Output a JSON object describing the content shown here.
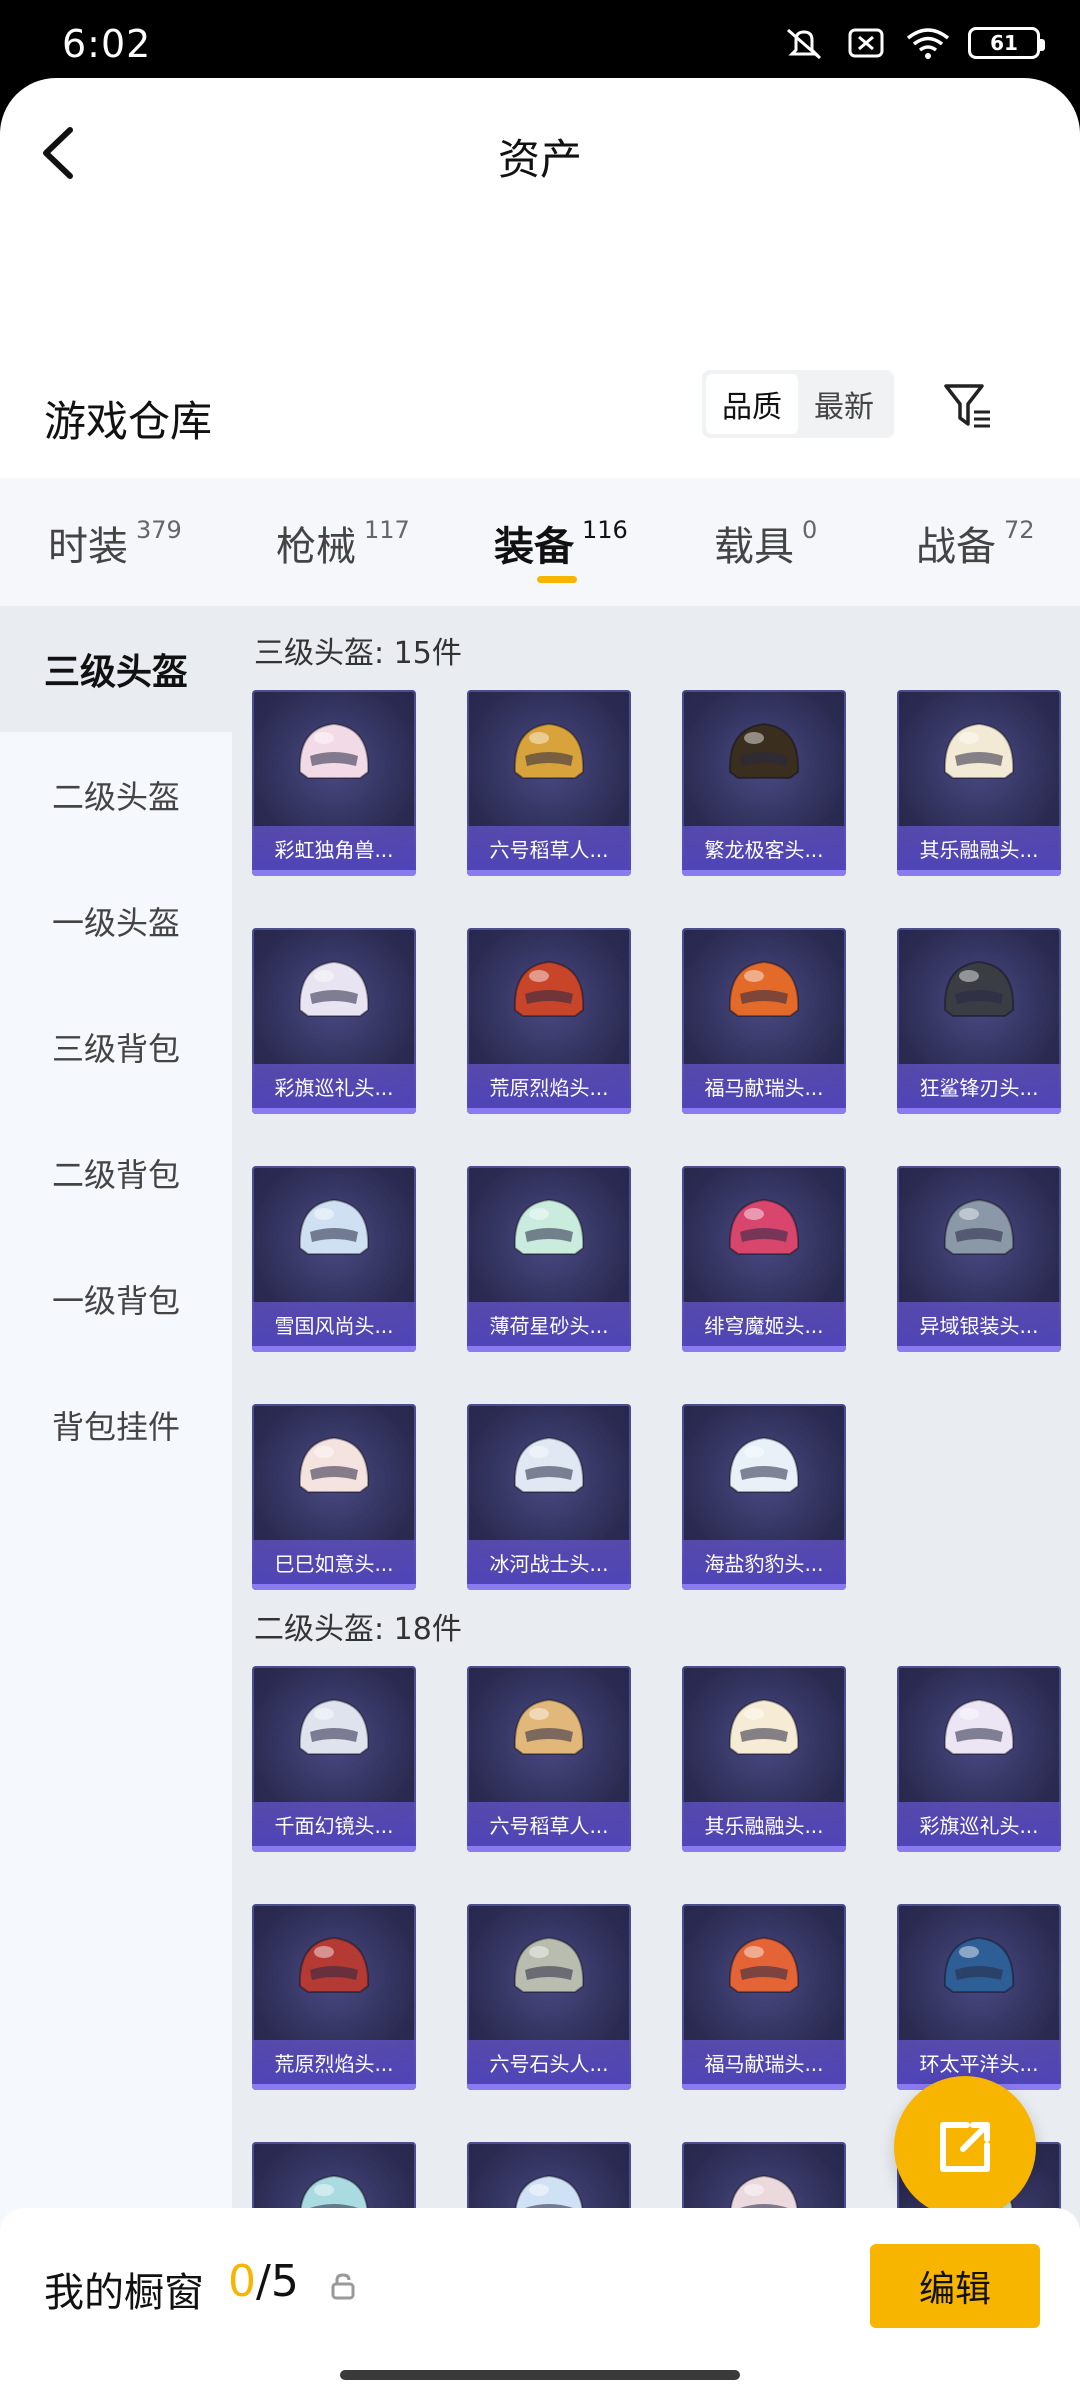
{
  "status_bar": {
    "time": "6:02",
    "battery": "61"
  },
  "nav": {
    "title": "资产"
  },
  "warehouse": {
    "title": "游戏仓库",
    "sort_options": [
      "品质",
      "最新"
    ],
    "active_sort": "品质"
  },
  "categories": [
    {
      "label": "时装",
      "count": "379"
    },
    {
      "label": "枪械",
      "count": "117"
    },
    {
      "label": "装备",
      "count": "116",
      "active": true
    },
    {
      "label": "载具",
      "count": "0"
    },
    {
      "label": "战备",
      "count": "72"
    }
  ],
  "sidebar": [
    {
      "label": "三级头盔",
      "active": true
    },
    {
      "label": "二级头盔"
    },
    {
      "label": "一级头盔"
    },
    {
      "label": "三级背包"
    },
    {
      "label": "二级背包"
    },
    {
      "label": "一级背包"
    },
    {
      "label": "背包挂件"
    }
  ],
  "sections": [
    {
      "title": "三级头盔: 15件",
      "items": [
        {
          "name": "彩虹独角兽...",
          "color": "#f2dbe6"
        },
        {
          "name": "六号稻草人...",
          "color": "#d9a33b"
        },
        {
          "name": "繁龙极客头...",
          "color": "#3a2e1e"
        },
        {
          "name": "其乐融融头...",
          "color": "#f3ead6"
        },
        {
          "name": "彩旗巡礼头...",
          "color": "#e8e4f1"
        },
        {
          "name": "荒原烈焰头...",
          "color": "#c8452a"
        },
        {
          "name": "福马献瑞头...",
          "color": "#e46a2a"
        },
        {
          "name": "狂鲨锋刃头...",
          "color": "#3b3d44"
        },
        {
          "name": "雪国风尚头...",
          "color": "#cfe0f2"
        },
        {
          "name": "薄荷星砂头...",
          "color": "#c9ecde"
        },
        {
          "name": "绯穹魔姬头...",
          "color": "#d8456d"
        },
        {
          "name": "异域银装头...",
          "color": "#8a98a8"
        },
        {
          "name": "巳巳如意头...",
          "color": "#f5e3e0"
        },
        {
          "name": "冰河战士头...",
          "color": "#dfe8f3"
        },
        {
          "name": "海盐豹豹头...",
          "color": "#e8f1f8"
        }
      ]
    },
    {
      "title": "二级头盔: 18件",
      "items": [
        {
          "name": "千面幻镜头...",
          "color": "#dfe3ee"
        },
        {
          "name": "六号稻草人...",
          "color": "#e1b87a"
        },
        {
          "name": "其乐融融头...",
          "color": "#f6ecd5"
        },
        {
          "name": "彩旗巡礼头...",
          "color": "#ece6f4"
        },
        {
          "name": "荒原烈焰头...",
          "color": "#b53a33"
        },
        {
          "name": "六号石头人...",
          "color": "#b8bdb0"
        },
        {
          "name": "福马献瑞头...",
          "color": "#e56436"
        },
        {
          "name": "环太平洋头...",
          "color": "#2d5f96"
        },
        {
          "name": "",
          "color": "#a9dbe0"
        },
        {
          "name": "",
          "color": "#cfe1f4"
        },
        {
          "name": "",
          "color": "#ecd9de"
        },
        {
          "name": "",
          "color": "#cfe9da"
        }
      ]
    }
  ],
  "bottom": {
    "label": "我的橱窗",
    "current": "0",
    "total": "/5",
    "edit_label": "编辑"
  },
  "colors": {
    "accent": "#f7b500",
    "card_bg": "#2b2b52",
    "label_bg": "#5a48c4"
  }
}
